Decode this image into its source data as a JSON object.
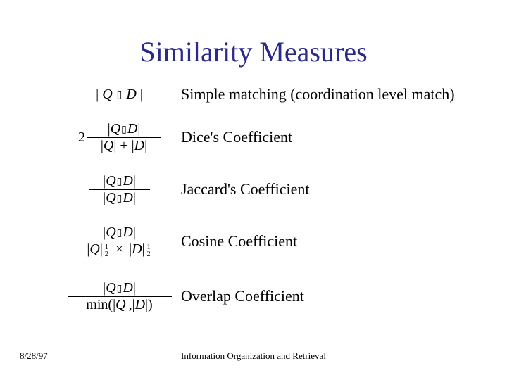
{
  "title": "Similarity Measures",
  "measures": {
    "simple": {
      "label": "Simple matching (coordination level match)"
    },
    "dice": {
      "label": "Dice's Coefficient"
    },
    "jaccard": {
      "label": "Jaccard's Coefficient"
    },
    "cosine": {
      "label": "Cosine Coefficient"
    },
    "overlap": {
      "label": "Overlap Coefficient"
    }
  },
  "symbols": {
    "Q": "Q",
    "D": "D",
    "pipe": "|",
    "plus": "+",
    "minus": "−",
    "times": "×",
    "min": "min",
    "comma": ",",
    "lparen": "(",
    "rparen": ")",
    "two": "2",
    "half_num": "1",
    "half_den": "2",
    "inter_placeholder": "▯"
  },
  "footer": {
    "date": "8/28/97",
    "source": "Information Organization and Retrieval"
  }
}
